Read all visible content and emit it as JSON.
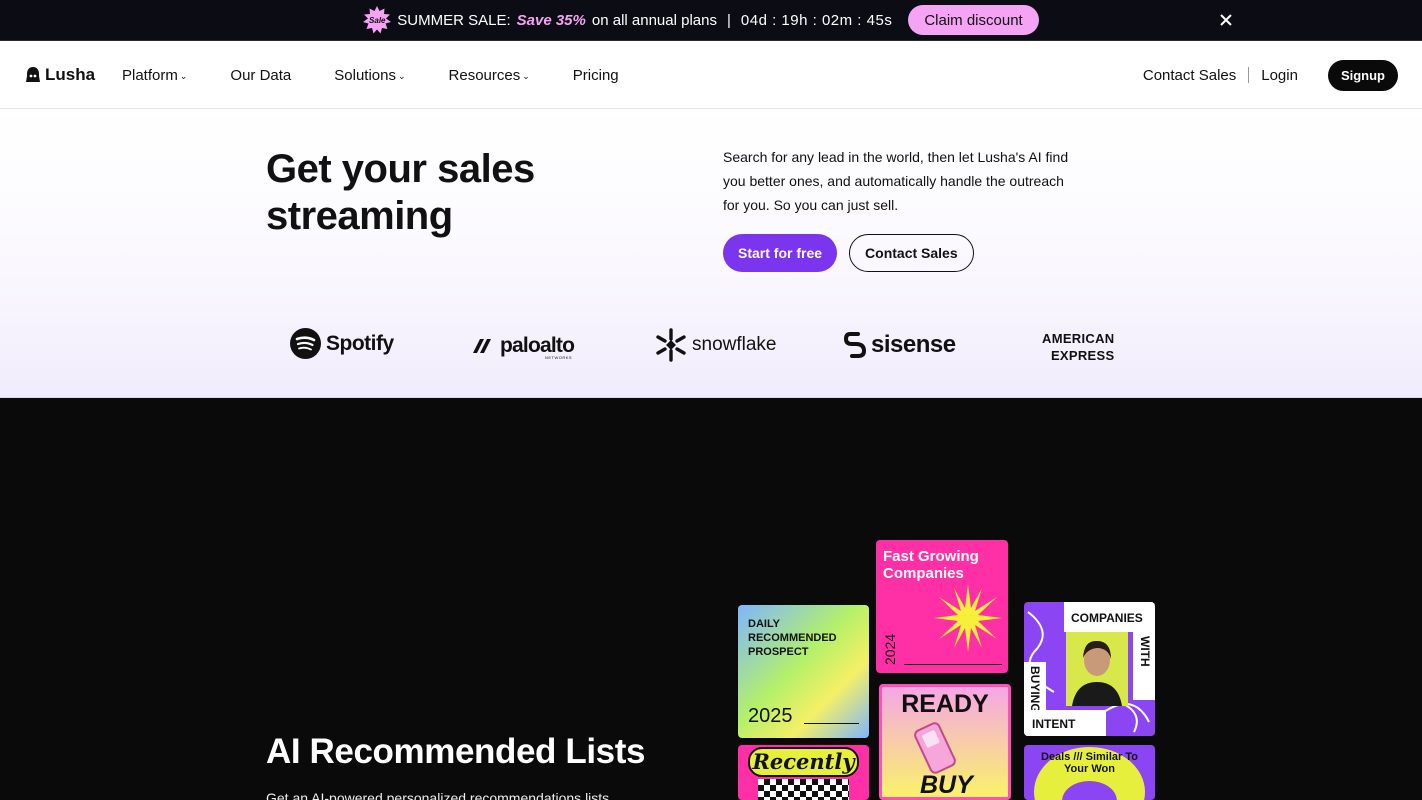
{
  "promo": {
    "badge": "Sale",
    "sale_label": "SUMMER SALE:",
    "save_text": "Save 35%",
    "plans_text": "on all annual plans",
    "separator": "|",
    "countdown": "04d : 19h : 02m : 45s",
    "claim_label": "Claim discount",
    "close_icon": "close-icon"
  },
  "nav": {
    "logo": "Lusha",
    "links": [
      {
        "label": "Platform",
        "has_dropdown": true
      },
      {
        "label": "Our Data",
        "has_dropdown": false
      },
      {
        "label": "Solutions",
        "has_dropdown": true
      },
      {
        "label": "Resources",
        "has_dropdown": true
      },
      {
        "label": "Pricing",
        "has_dropdown": false
      }
    ],
    "contact_sales": "Contact Sales",
    "divider": "|",
    "login": "Login",
    "signup": "Signup"
  },
  "hero": {
    "title": "Get your sales streaming",
    "description": "Search for any lead in the world, then let Lusha's AI find you better ones, and automatically handle the outreach for you. So you can just sell.",
    "primary_cta": "Start for free",
    "secondary_cta": "Contact Sales",
    "logos": [
      "Spotify",
      "paloalto",
      "NETWORKS",
      "snowflake",
      "sisense",
      "AMERICAN",
      "EXPRESS"
    ]
  },
  "feature": {
    "title": "AI Recommended Lists",
    "subtitle": "Get an AI-powered personalized recommendations lists",
    "cards": {
      "daily_title": "DAILY RECOMMENDED PROSPECT",
      "daily_year": "2025",
      "fast_title": "Fast Growing Companies",
      "fast_year": "2024",
      "companies_top": "COMPANIES",
      "companies_right": "WITH",
      "companies_left": "BUYING",
      "companies_bottom": "INTENT",
      "ready_top": "READY",
      "ready_bottom": "BUY",
      "recently": "Recently",
      "similar": "Deals /// Similar To Your Won"
    }
  },
  "colors": {
    "promo_bg": "#0c0c14",
    "promo_accent": "#f5a3f5",
    "primary": "#7b35ee",
    "dark_section": "#0a0a0a",
    "pink": "#ff2fa5",
    "purple": "#8b45f2",
    "yellow": "#e6f03c"
  }
}
